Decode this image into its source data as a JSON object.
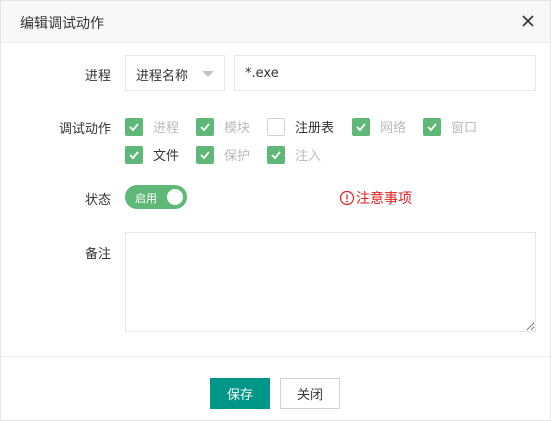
{
  "dialog": {
    "title": "编辑调试动作"
  },
  "form": {
    "process_label": "进程",
    "process_select_value": "进程名称",
    "process_input_value": "*.exe",
    "actions_label": "调试动作",
    "actions": [
      {
        "label": "进程",
        "checked": true
      },
      {
        "label": "模块",
        "checked": true
      },
      {
        "label": "注册表",
        "checked": false
      },
      {
        "label": "网络",
        "checked": true
      },
      {
        "label": "窗口",
        "checked": true
      },
      {
        "label": "文件",
        "checked": true
      },
      {
        "label": "保护",
        "checked": true
      },
      {
        "label": "注入",
        "checked": true
      }
    ],
    "status_label": "状态",
    "status_switch_text": "启用",
    "status_on": true,
    "notice_text": "注意事项",
    "remark_label": "备注",
    "remark_value": ""
  },
  "footer": {
    "save_label": "保存",
    "close_label": "关闭"
  },
  "colors": {
    "checkbox_checked": "#5fb878",
    "switch_on": "#5fb878",
    "primary_button": "#009688",
    "notice": "#e02020"
  },
  "icons": {
    "close": "close-icon",
    "select_arrow": "caret-down-icon",
    "checkmark": "checkmark-icon",
    "notice": "info-circle-icon"
  }
}
